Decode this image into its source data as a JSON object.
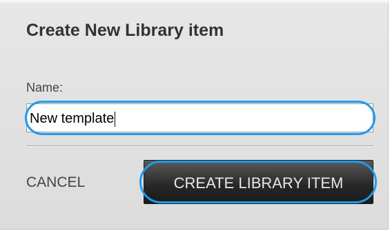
{
  "dialog": {
    "title": "Create New Library item",
    "name_label": "Name:",
    "name_value": "New template",
    "cancel_label": "CANCEL",
    "create_label": "CREATE LIBRARY ITEM"
  },
  "colors": {
    "highlight": "#1e9bee",
    "button_dark": "#262626",
    "dialog_bg": "#e2e2e2"
  }
}
